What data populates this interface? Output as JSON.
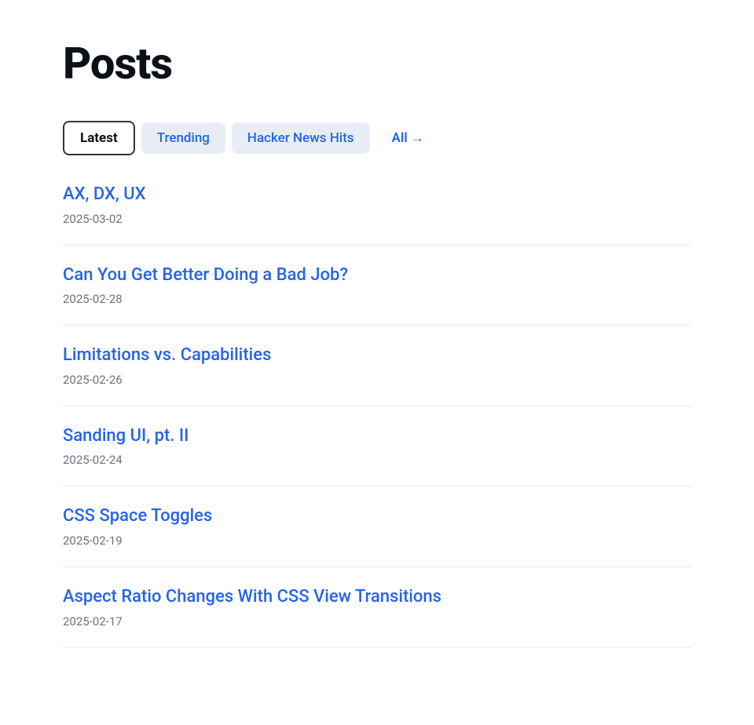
{
  "page": {
    "title": "Posts"
  },
  "tabs": [
    {
      "id": "latest",
      "label": "Latest",
      "active": true
    },
    {
      "id": "trending",
      "label": "Trending",
      "active": false
    },
    {
      "id": "hacker-news-hits",
      "label": "Hacker News Hits",
      "active": false
    },
    {
      "id": "all",
      "label": "All →",
      "active": false,
      "is_all": true
    }
  ],
  "posts": [
    {
      "title": "AX, DX, UX",
      "date": "2025-03-02"
    },
    {
      "title": "Can You Get Better Doing a Bad Job?",
      "date": "2025-02-28"
    },
    {
      "title": "Limitations vs. Capabilities",
      "date": "2025-02-26"
    },
    {
      "title": "Sanding UI, pt. II",
      "date": "2025-02-24"
    },
    {
      "title": "CSS Space Toggles",
      "date": "2025-02-19"
    },
    {
      "title": "Aspect Ratio Changes With CSS View Transitions",
      "date": "2025-02-17"
    }
  ]
}
